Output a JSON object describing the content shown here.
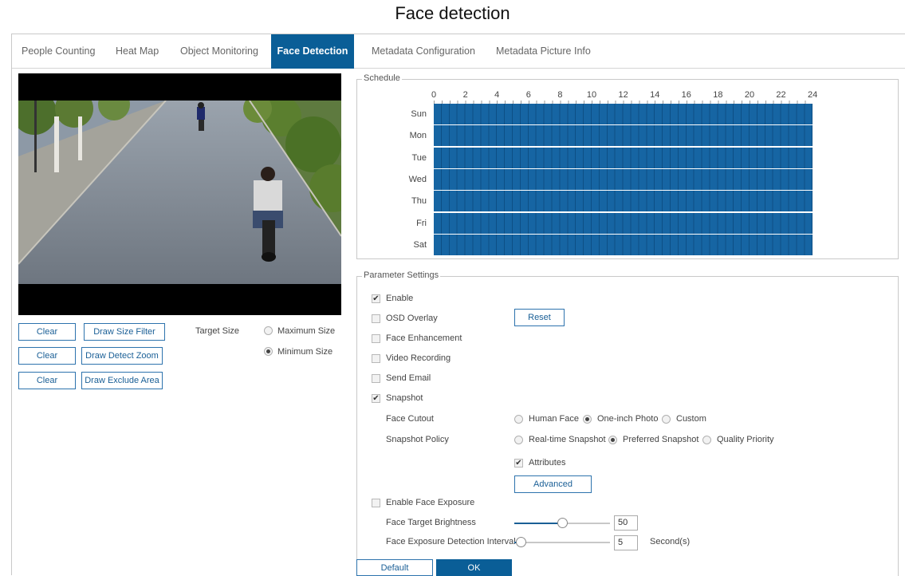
{
  "page": {
    "title": "Face detection"
  },
  "tabs": [
    {
      "label": "People Counting"
    },
    {
      "label": "Heat Map"
    },
    {
      "label": "Object Monitoring"
    },
    {
      "label": "Face Detection"
    },
    {
      "label": "Metadata Configuration"
    },
    {
      "label": "Metadata Picture Info"
    }
  ],
  "active_tab": "Face Detection",
  "left": {
    "buttons": {
      "clear": "Clear",
      "draw_size_filter": "Draw Size Filter",
      "draw_detect_zoom": "Draw Detect Zoom",
      "draw_exclude_area": "Draw Exclude Area"
    },
    "target_size": {
      "label": "Target Size",
      "options": [
        "Maximum Size",
        "Minimum Size"
      ],
      "selected": "Minimum Size"
    }
  },
  "schedule": {
    "legend": "Schedule",
    "hours": [
      "0",
      "2",
      "4",
      "6",
      "8",
      "10",
      "12",
      "14",
      "16",
      "18",
      "20",
      "22",
      "24"
    ],
    "days": [
      "Sun",
      "Mon",
      "Tue",
      "Wed",
      "Thu",
      "Fri",
      "Sat"
    ],
    "fill_color": "#1665a3"
  },
  "params": {
    "legend": "Parameter Settings",
    "enable": {
      "label": "Enable",
      "checked": true
    },
    "osd_overlay": {
      "label": "OSD Overlay",
      "checked": false
    },
    "reset_label": "Reset",
    "face_enhancement": {
      "label": "Face Enhancement",
      "checked": false
    },
    "video_recording": {
      "label": "Video Recording",
      "checked": false
    },
    "send_email": {
      "label": "Send Email",
      "checked": false
    },
    "snapshot": {
      "label": "Snapshot",
      "checked": true
    },
    "face_cutout": {
      "label": "Face Cutout",
      "options": [
        "Human Face",
        "One-inch Photo",
        "Custom"
      ],
      "selected": "One-inch Photo"
    },
    "snapshot_policy": {
      "label": "Snapshot Policy",
      "options": [
        "Real-time Snapshot",
        "Preferred Snapshot",
        "Quality Priority"
      ],
      "selected": "Preferred Snapshot"
    },
    "attributes": {
      "label": "Attributes",
      "checked": true
    },
    "advanced_label": "Advanced",
    "face_exposure": {
      "label": "Enable Face Exposure",
      "checked": false
    },
    "brightness": {
      "label": "Face Target Brightness",
      "value": "50",
      "fraction": 0.5
    },
    "interval": {
      "label": "Face Exposure Detection Interval",
      "value": "5",
      "unit": "Second(s)",
      "fraction": 0.03
    }
  },
  "footer": {
    "default_label": "Default",
    "ok_label": "OK"
  },
  "colors": {
    "accent": "#0a5e97",
    "schedule": "#1665a3"
  }
}
